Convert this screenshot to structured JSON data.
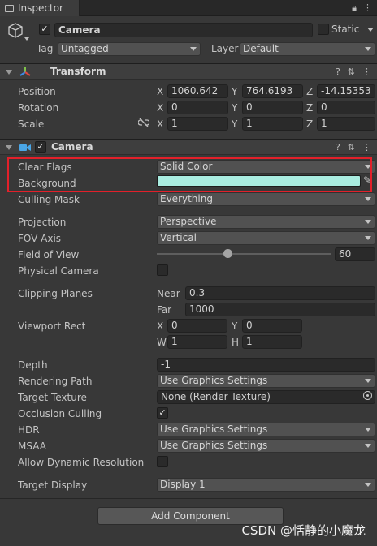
{
  "tab": {
    "title": "Inspector"
  },
  "object": {
    "name": "Camera",
    "static_label": "Static",
    "tag_label": "Tag",
    "tag_value": "Untagged",
    "layer_label": "Layer",
    "layer_value": "Default"
  },
  "transform": {
    "title": "Transform",
    "position_label": "Position",
    "position": {
      "x": "1060.642",
      "y": "764.6193",
      "z": "-14.15353"
    },
    "rotation_label": "Rotation",
    "rotation": {
      "x": "0",
      "y": "0",
      "z": "0"
    },
    "scale_label": "Scale",
    "scale": {
      "x": "1",
      "y": "1",
      "z": "1"
    }
  },
  "axes": {
    "x": "X",
    "y": "Y",
    "z": "Z",
    "w": "W",
    "h": "H"
  },
  "camera": {
    "title": "Camera",
    "clear_flags_label": "Clear Flags",
    "clear_flags": "Solid Color",
    "background_label": "Background",
    "background_color": "#a9ece0",
    "culling_mask_label": "Culling Mask",
    "culling_mask": "Everything",
    "projection_label": "Projection",
    "projection": "Perspective",
    "fov_axis_label": "FOV Axis",
    "fov_axis": "Vertical",
    "fov_label": "Field of View",
    "fov_value": "60",
    "fov_fraction": 0.41,
    "physical_camera_label": "Physical Camera",
    "clipping_label": "Clipping Planes",
    "near_label": "Near",
    "near": "0.3",
    "far_label": "Far",
    "far": "1000",
    "viewport_label": "Viewport Rect",
    "viewport": {
      "x": "0",
      "y": "0",
      "w": "1",
      "h": "1"
    },
    "depth_label": "Depth",
    "depth": "-1",
    "rendering_path_label": "Rendering Path",
    "rendering_path": "Use Graphics Settings",
    "target_texture_label": "Target Texture",
    "target_texture": "None (Render Texture)",
    "occlusion_label": "Occlusion Culling",
    "hdr_label": "HDR",
    "hdr": "Use Graphics Settings",
    "msaa_label": "MSAA",
    "msaa": "Use Graphics Settings",
    "dynamic_res_label": "Allow Dynamic Resolution",
    "target_display_label": "Target Display",
    "target_display": "Display 1"
  },
  "add_component": "Add Component",
  "watermark": "CSDN @恬静的小魔龙",
  "colors": {
    "highlight": "#e2202a",
    "checkbox_accent": "#e6e6e6"
  }
}
